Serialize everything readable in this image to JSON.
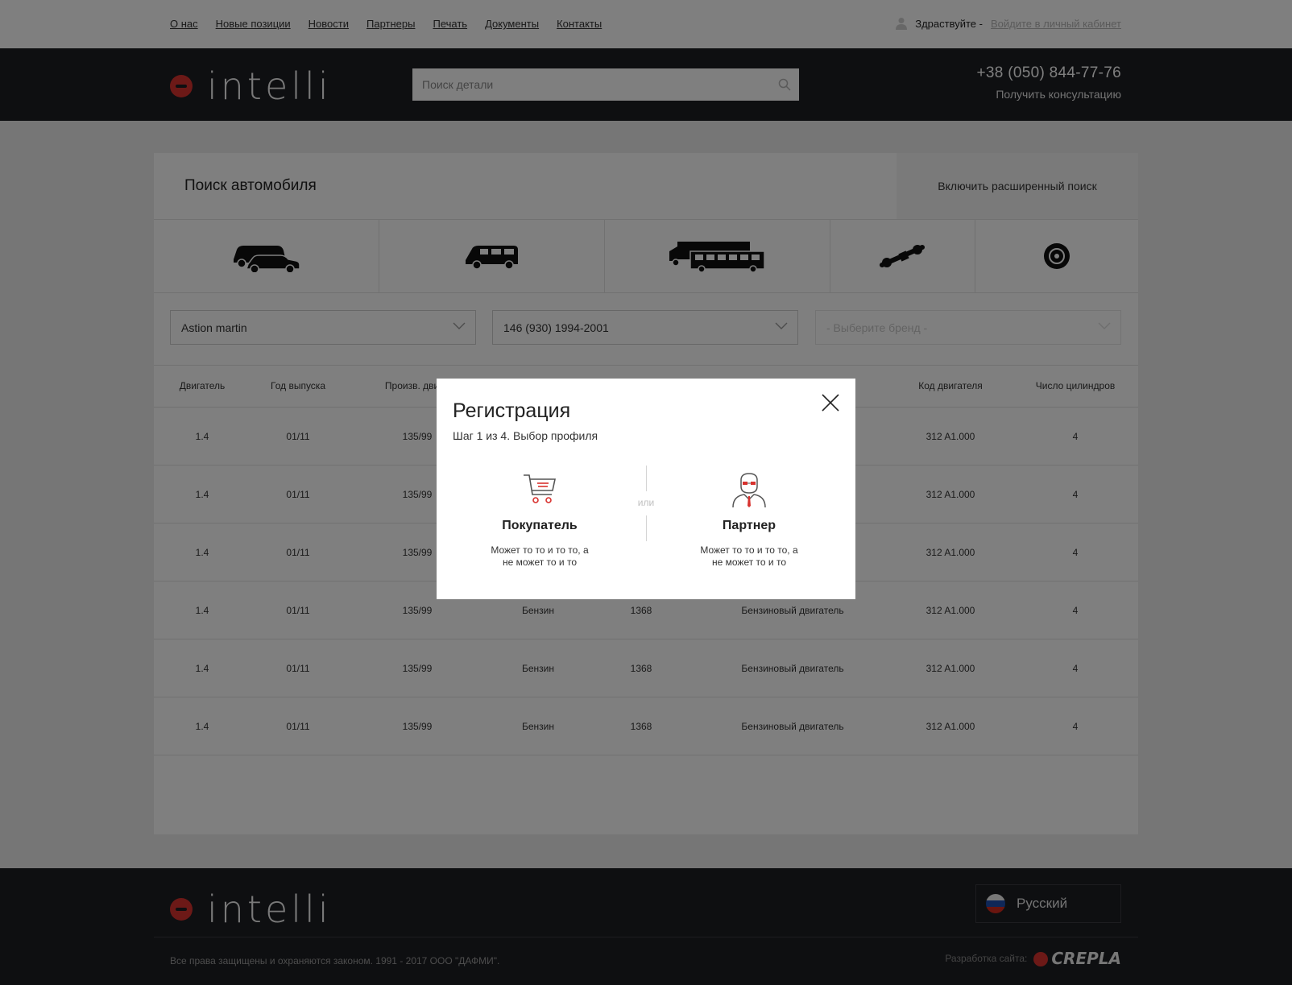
{
  "nav": {
    "links": [
      "О нас",
      "Новые позиции",
      "Новости",
      "Партнеры",
      "Печать",
      "Документы",
      "Контакты"
    ],
    "greeting": "Здраствуйте -",
    "login_link": "Войдите в личный кабинет"
  },
  "header": {
    "logo_text": "intelli",
    "search_placeholder": "Поиск детали",
    "phone": "+38 (050) 844-77-76",
    "consult": "Получить консультацию"
  },
  "search_panel": {
    "title": "Поиск автомобиля",
    "advanced_toggle": "Включить расширенный поиск",
    "categories": [
      "car-and-van-icon",
      "minivan-icon",
      "truck-and-bus-icon",
      "axle-icon",
      "brake-disc-icon"
    ],
    "filters": {
      "make": "Astion martin",
      "model": "146 (930) 1994-2001",
      "brand_placeholder": "- Выберите бренд -"
    }
  },
  "table": {
    "headers": [
      "Двигатель",
      "Год выпуска",
      "Произв. двиг. [",
      "",
      "",
      "",
      "Код двигателя",
      "Число цилиндров"
    ],
    "rows": [
      [
        "1.4",
        "01/11",
        "135/99",
        "",
        "",
        "",
        "312 A1.000",
        "4"
      ],
      [
        "1.4",
        "01/11",
        "135/99",
        "",
        "",
        "",
        "312 A1.000",
        "4"
      ],
      [
        "1.4",
        "01/11",
        "135/99",
        "",
        "",
        "",
        "312 A1.000",
        "4"
      ],
      [
        "1.4",
        "01/11",
        "135/99",
        "Бензин",
        "1368",
        "Бензиновый двигатель",
        "312 A1.000",
        "4"
      ],
      [
        "1.4",
        "01/11",
        "135/99",
        "Бензин",
        "1368",
        "Бензиновый двигатель",
        "312 A1.000",
        "4"
      ],
      [
        "1.4",
        "01/11",
        "135/99",
        "Бензин",
        "1368",
        "Бензиновый двигатель",
        "312 A1.000",
        "4"
      ]
    ]
  },
  "footer": {
    "logo_text": "intelli",
    "language": "Русский",
    "copyright": "Все права защищены и охраняются законом. 1991 - 2017 ООО \"ДАФМИ\".",
    "developer_label": "Разработка сайта:",
    "developer_name": "CREPLA"
  },
  "modal": {
    "title": "Регистрация",
    "step": "Шаг 1 из 4. Выбор профиля",
    "or": "или",
    "options": [
      {
        "name": "Покупатель",
        "desc1": "Может то то и то то, а",
        "desc2": "не может то и то",
        "icon": "shopping-cart-icon"
      },
      {
        "name": "Партнер",
        "desc1": "Может то то и то то, а",
        "desc2": "не может то и то",
        "icon": "businessman-icon"
      }
    ]
  },
  "colors": {
    "accent": "#d8322f",
    "dark": "#1d1e23",
    "overlay": "rgba(0,0,0,0.5)"
  }
}
